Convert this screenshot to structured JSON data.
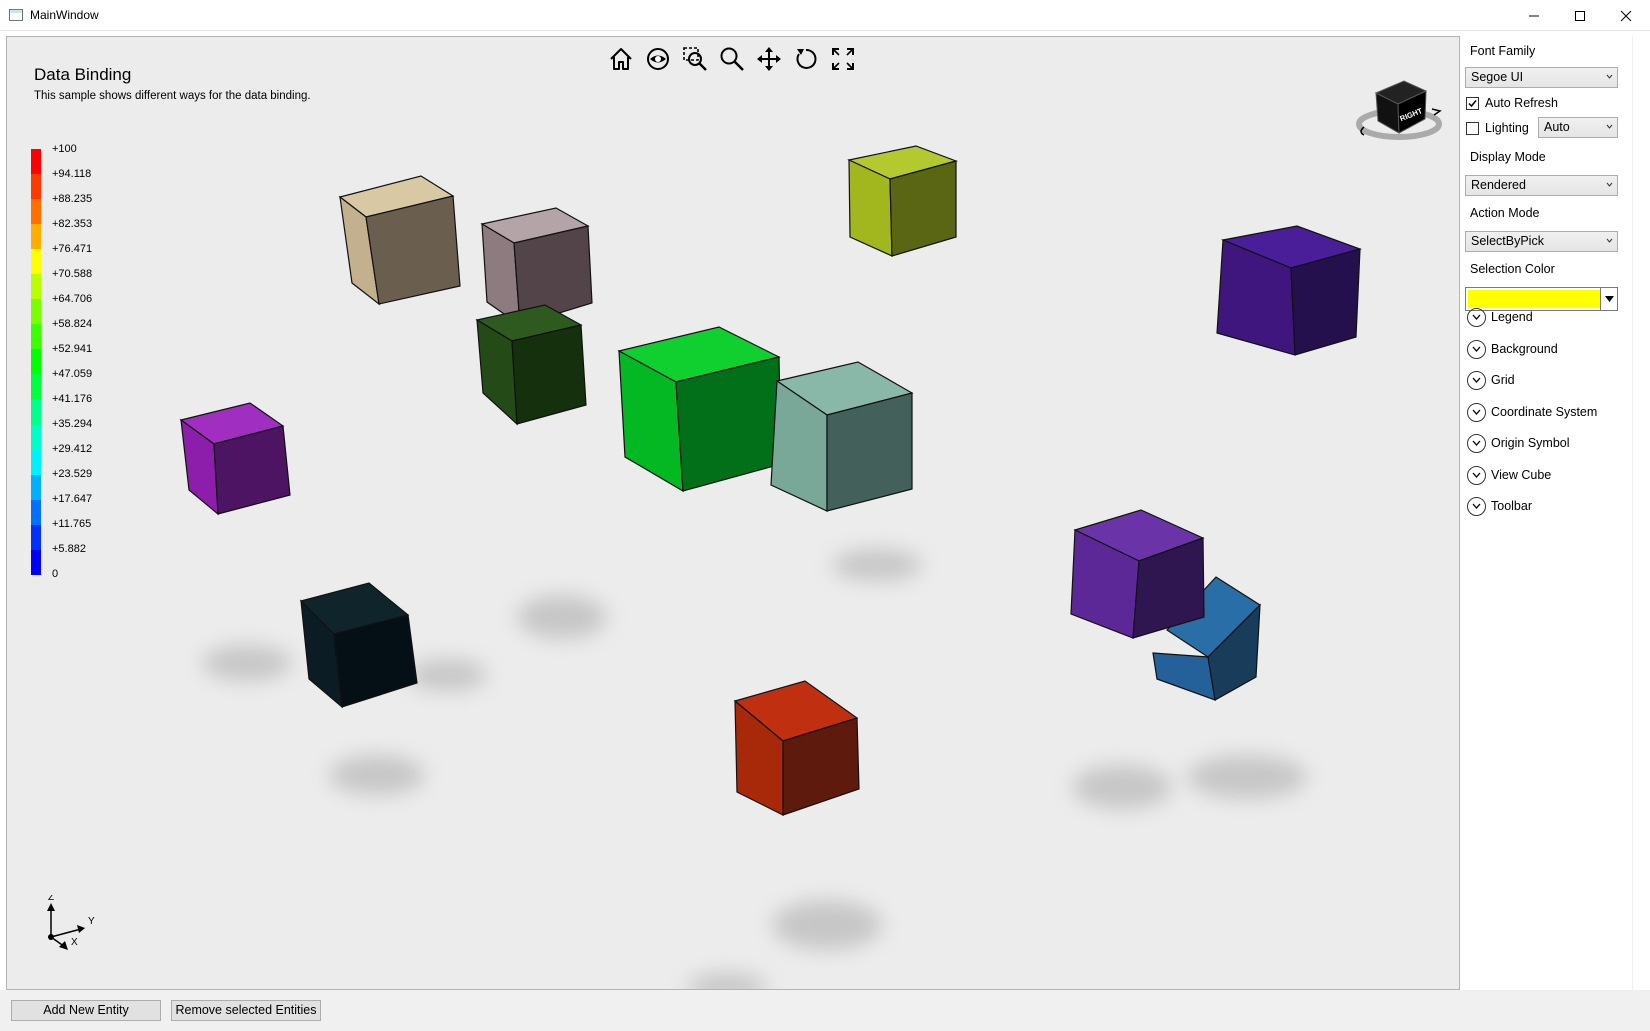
{
  "window": {
    "title": "MainWindow"
  },
  "viewport": {
    "title": "Data Binding",
    "subtitle": "This sample shows different ways for the data binding."
  },
  "toolbar": {
    "icons": [
      "home-icon",
      "eye-icon",
      "zoom-window-icon",
      "zoom-icon",
      "pan-icon",
      "rotate-icon",
      "zoom-fit-icon"
    ]
  },
  "legend": {
    "labels": [
      "+100",
      "+94.118",
      "+88.235",
      "+82.353",
      "+76.471",
      "+70.588",
      "+64.706",
      "+58.824",
      "+52.941",
      "+47.059",
      "+41.176",
      "+35.294",
      "+29.412",
      "+23.529",
      "+17.647",
      "+11.765",
      "+5.882",
      "0"
    ],
    "colors": [
      "#ff0000",
      "#ff3a00",
      "#ff7000",
      "#ffae00",
      "#ffff00",
      "#b8ff00",
      "#7aff00",
      "#3cff00",
      "#00ff00",
      "#00ff3c",
      "#00ff8c",
      "#00ffc8",
      "#00f0ff",
      "#00b0ff",
      "#0070ff",
      "#0030ff",
      "#0000ff"
    ]
  },
  "viewcube": {
    "face_label": "RIGHT"
  },
  "axes": {
    "z": "Z",
    "y": "Y",
    "x": "X"
  },
  "side": {
    "font_family_label": "Font Family",
    "font_family_value": "Segoe UI",
    "auto_refresh_label": "Auto Refresh",
    "auto_refresh_checked": true,
    "lighting_label": "Lighting",
    "lighting_checked": false,
    "lighting_value": "Auto",
    "display_mode_label": "Display Mode",
    "display_mode_value": "Rendered",
    "action_mode_label": "Action Mode",
    "action_mode_value": "SelectByPick",
    "selection_color_label": "Selection Color",
    "selection_color": "#ffff00",
    "expanders": [
      "Legend",
      "Background",
      "Grid",
      "Coordinate System",
      "Origin Symbol",
      "View Cube",
      "Toolbar"
    ]
  },
  "buttons": {
    "add": "Add New Entity",
    "remove": "Remove selected Entities"
  }
}
